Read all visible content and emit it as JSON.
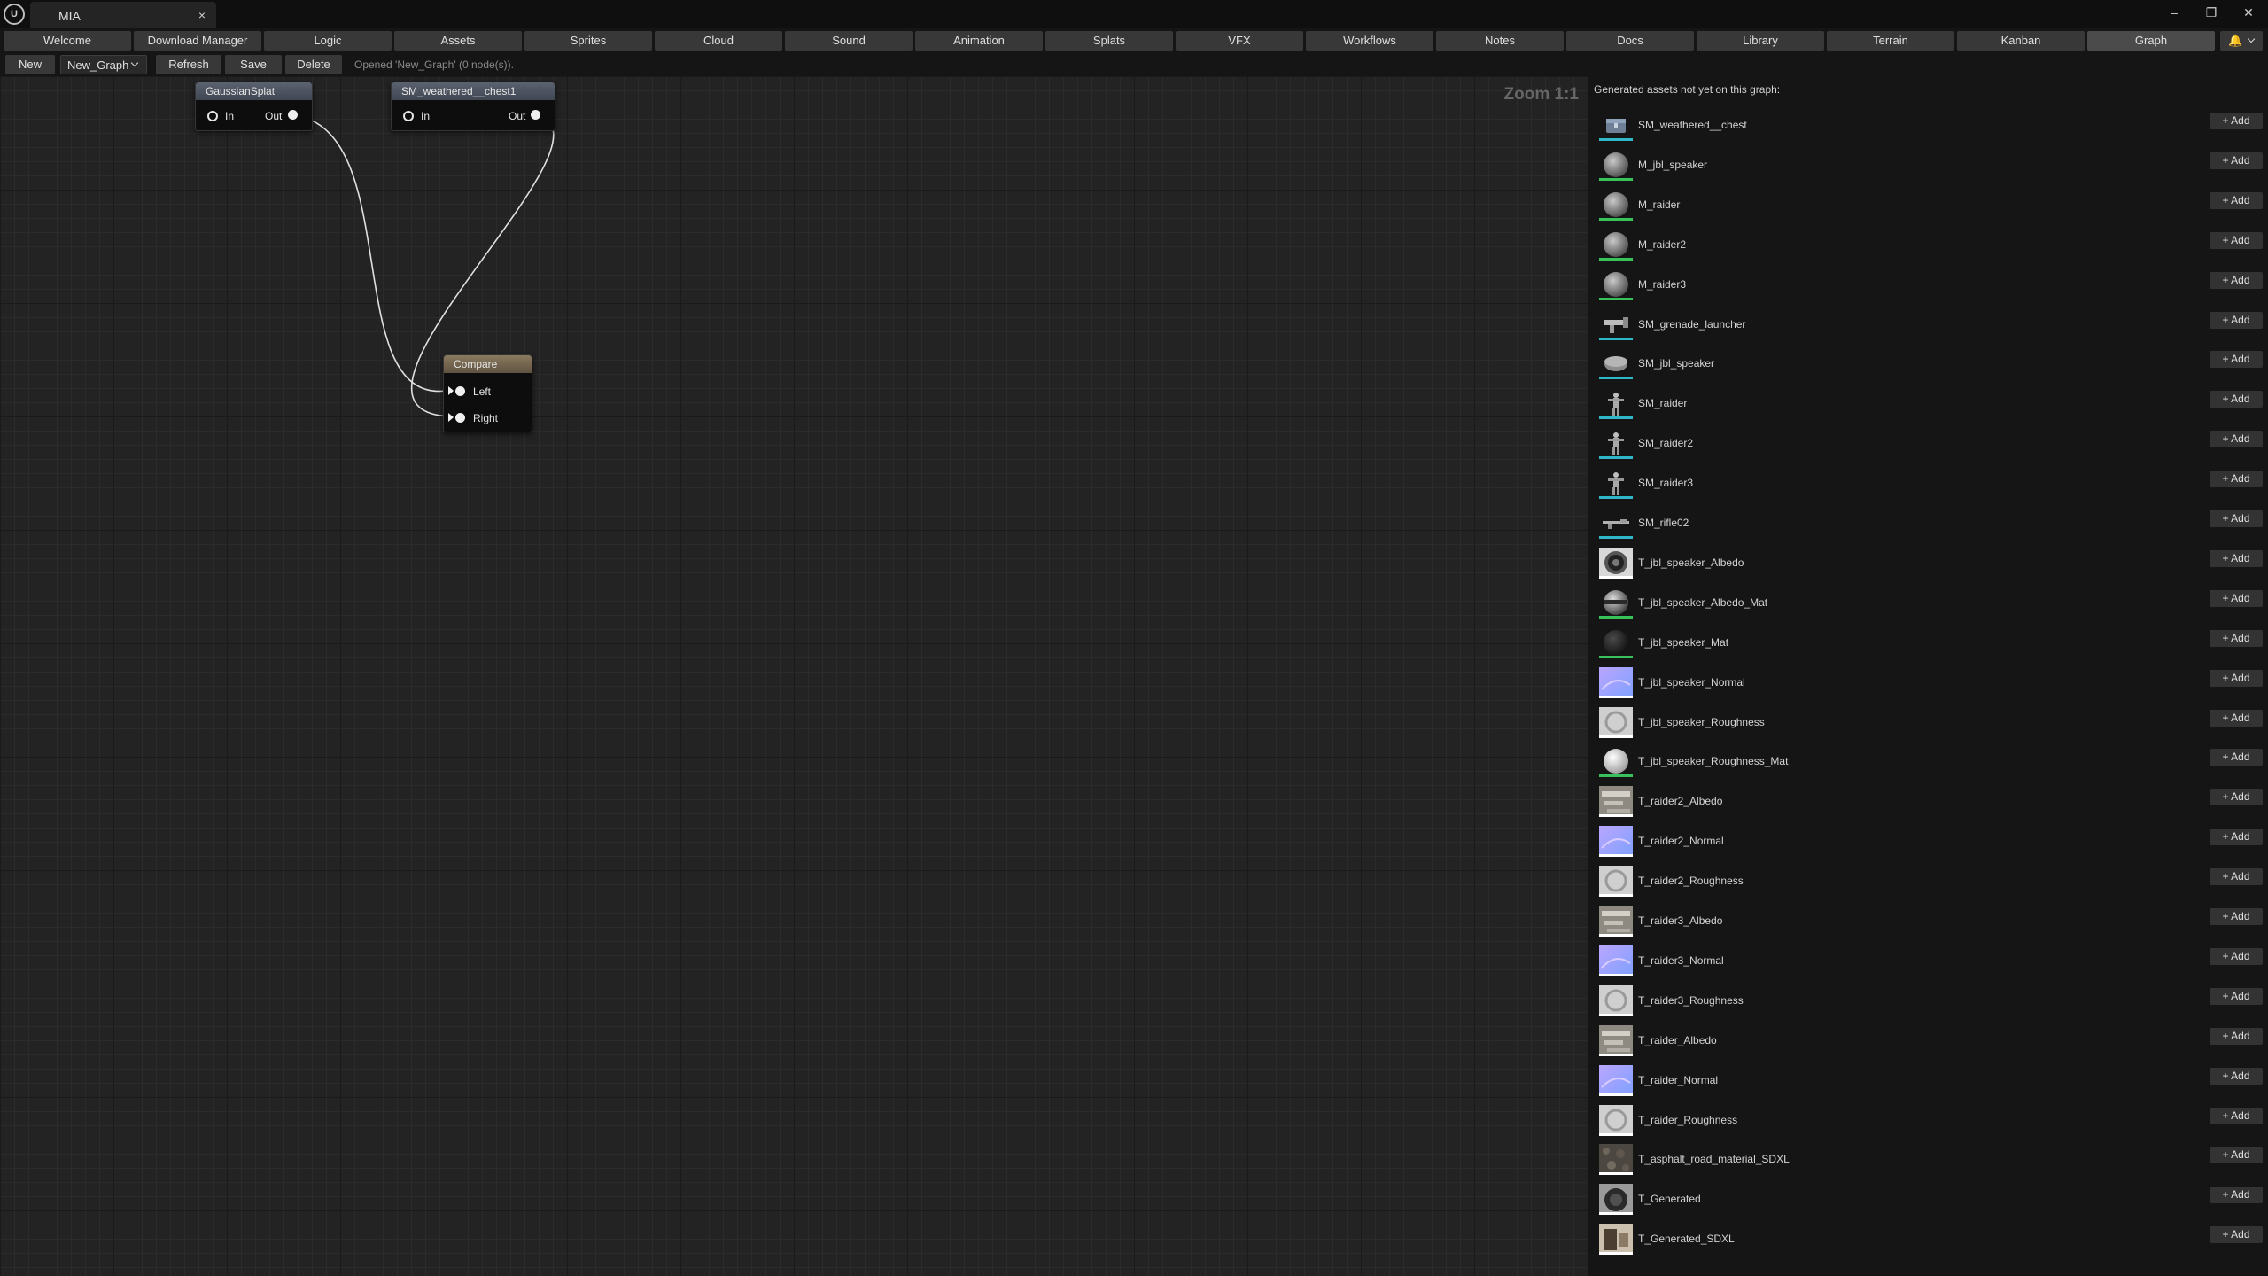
{
  "window": {
    "tab_title": "MIA",
    "tab_close": "×",
    "minimize": "–",
    "restore": "❐",
    "close": "✕"
  },
  "nav_tabs": [
    {
      "label": "Welcome"
    },
    {
      "label": "Download Manager"
    },
    {
      "label": "Logic"
    },
    {
      "label": "Assets"
    },
    {
      "label": "Sprites"
    },
    {
      "label": "Cloud"
    },
    {
      "label": "Sound"
    },
    {
      "label": "Animation"
    },
    {
      "label": "Splats"
    },
    {
      "label": "VFX"
    },
    {
      "label": "Workflows"
    },
    {
      "label": "Notes"
    },
    {
      "label": "Docs"
    },
    {
      "label": "Library"
    },
    {
      "label": "Terrain"
    },
    {
      "label": "Kanban"
    },
    {
      "label": "Graph",
      "active": true
    }
  ],
  "toolbar": {
    "new_label": "New",
    "graph_select_value": "New_Graph",
    "refresh_label": "Refresh",
    "save_label": "Save",
    "delete_label": "Delete",
    "status": "Opened 'New_Graph' (0 node(s))."
  },
  "canvas": {
    "zoom_label": "Zoom 1:1",
    "nodes": {
      "gaussian": {
        "title": "GaussianSplat",
        "in_label": "In",
        "out_label": "Out"
      },
      "chest": {
        "title": "SM_weathered__chest1",
        "in_label": "In",
        "out_label": "Out"
      },
      "compare": {
        "title": "Compare",
        "left_label": "Left",
        "right_label": "Right"
      }
    }
  },
  "assets_panel": {
    "heading": "Generated assets not yet on this graph:",
    "add_label": "+ Add",
    "items": [
      {
        "name": "SM_weathered__chest",
        "icon": "chest-mesh-icon",
        "accent": "#2fb8c8"
      },
      {
        "name": "M_jbl_speaker",
        "icon": "material-sphere-icon",
        "accent": "#38c25a"
      },
      {
        "name": "M_raider",
        "icon": "material-sphere-icon",
        "accent": "#38c25a"
      },
      {
        "name": "M_raider2",
        "icon": "material-sphere-icon",
        "accent": "#38c25a"
      },
      {
        "name": "M_raider3",
        "icon": "material-sphere-icon",
        "accent": "#38c25a"
      },
      {
        "name": "SM_grenade_launcher",
        "icon": "weapon-mesh-icon",
        "accent": "#2fb8c8"
      },
      {
        "name": "SM_jbl_speaker",
        "icon": "speaker-mesh-icon",
        "accent": "#2fb8c8"
      },
      {
        "name": "SM_raider",
        "icon": "figure-mesh-icon",
        "accent": "#2fb8c8"
      },
      {
        "name": "SM_raider2",
        "icon": "figure-mesh-icon",
        "accent": "#2fb8c8"
      },
      {
        "name": "SM_raider3",
        "icon": "figure-mesh-icon",
        "accent": "#2fb8c8"
      },
      {
        "name": "SM_rifle02",
        "icon": "rifle-mesh-icon",
        "accent": "#2fb8c8"
      },
      {
        "name": "T_jbl_speaker_Albedo",
        "icon": "speaker-texture-icon",
        "accent": "#ffffff"
      },
      {
        "name": "T_jbl_speaker_Albedo_Mat",
        "icon": "speaker-material-icon",
        "accent": "#38c25a"
      },
      {
        "name": "T_jbl_speaker_Mat",
        "icon": "dark-material-icon",
        "accent": "#38c25a"
      },
      {
        "name": "T_jbl_speaker_Normal",
        "icon": "normal-map-icon",
        "accent": "#ffffff"
      },
      {
        "name": "T_jbl_speaker_Roughness",
        "icon": "roughness-map-icon",
        "accent": "#ffffff"
      },
      {
        "name": "T_jbl_speaker_Roughness_Mat",
        "icon": "light-material-icon",
        "accent": "#38c25a"
      },
      {
        "name": "T_raider2_Albedo",
        "icon": "albedo-texture-icon",
        "accent": "#ffffff"
      },
      {
        "name": "T_raider2_Normal",
        "icon": "normal-map-icon",
        "accent": "#ffffff"
      },
      {
        "name": "T_raider2_Roughness",
        "icon": "roughness-map-icon",
        "accent": "#ffffff"
      },
      {
        "name": "T_raider3_Albedo",
        "icon": "albedo-texture-icon",
        "accent": "#ffffff"
      },
      {
        "name": "T_raider3_Normal",
        "icon": "normal-map-icon",
        "accent": "#ffffff"
      },
      {
        "name": "T_raider3_Roughness",
        "icon": "roughness-map-icon",
        "accent": "#ffffff"
      },
      {
        "name": "T_raider_Albedo",
        "icon": "albedo-texture-icon",
        "accent": "#ffffff"
      },
      {
        "name": "T_raider_Normal",
        "icon": "normal-map-icon",
        "accent": "#ffffff"
      },
      {
        "name": "T_raider_Roughness",
        "icon": "roughness-map-icon",
        "accent": "#ffffff"
      },
      {
        "name": "T_asphalt_road_material_SDXL",
        "icon": "asphalt-texture-icon",
        "accent": "#ffffff"
      },
      {
        "name": "T_Generated",
        "icon": "generated-texture-icon",
        "accent": "#ffffff"
      },
      {
        "name": "T_Generated_SDXL",
        "icon": "generated-photo-icon",
        "accent": "#ffffff"
      }
    ]
  },
  "colors": {
    "mesh_accent": "#2fb8c8",
    "material_accent": "#38c25a",
    "texture_accent": "#ffffff",
    "node_header": "#4e5562",
    "compare_header": "#7a6b53",
    "notification": "#f3b418"
  }
}
